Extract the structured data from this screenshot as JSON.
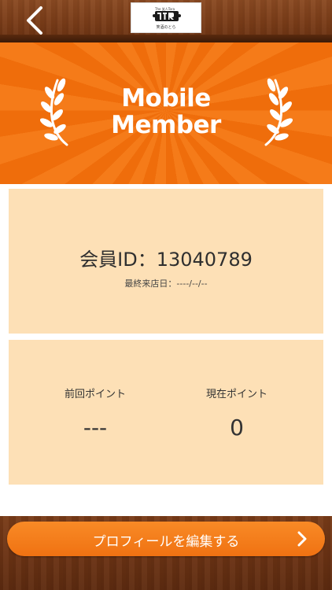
{
  "header": {
    "back_icon": "chevron-left-icon",
    "logo": {
      "icon": "store-logo",
      "brand_text": "笑酒のとら"
    }
  },
  "banner": {
    "title": "Mobile\nMember",
    "decoration_icon": "laurel-wreath-icon",
    "color_primary": "#f57b19",
    "color_secondary": "#ef6d0b"
  },
  "member": {
    "id_text": "会員ID：13040789",
    "last_visit_text": "最終来店日：----/--/--"
  },
  "points": {
    "previous": {
      "label": "前回ポイント",
      "value": "---"
    },
    "current": {
      "label": "現在ポイント",
      "value": "0"
    }
  },
  "footer": {
    "edit_profile_label": "プロフィールを編集する",
    "edit_profile_icon": "chevron-right-icon",
    "button_color": "#f57b19"
  },
  "colors": {
    "card_background": "#fde0b6",
    "wood": "#7a3c18"
  }
}
